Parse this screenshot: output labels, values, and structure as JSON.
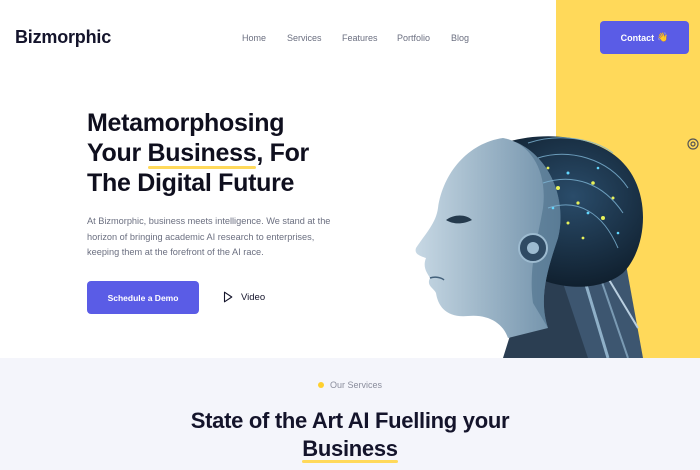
{
  "header": {
    "logo": "Bizmorphic",
    "nav": [
      "Home",
      "Services",
      "Features",
      "Portfolio",
      "Blog"
    ],
    "contact_label": "Contact",
    "contact_icon": "waving-hand-icon"
  },
  "hero": {
    "title_line1": "Metamorphosing",
    "title_line2_pre": "Your ",
    "title_line2_hl": "Business",
    "title_line2_post": ", For",
    "title_line3": "The Digital Future",
    "description": "At Bizmorphic, business meets intelligence. We stand at the horizon of bringing academic AI research to enterprises, keeping them at the forefront of the AI race.",
    "demo_label": "Schedule a Demo",
    "video_label": "Video"
  },
  "services": {
    "tag": "Our Services",
    "title_line1": "State of the Art AI Fuelling your",
    "title_line2": "Business"
  },
  "colors": {
    "accent": "#5a5ce6",
    "yellow": "#ffd95a",
    "text_dark": "#14142b",
    "text_muted": "#6b6f80"
  }
}
